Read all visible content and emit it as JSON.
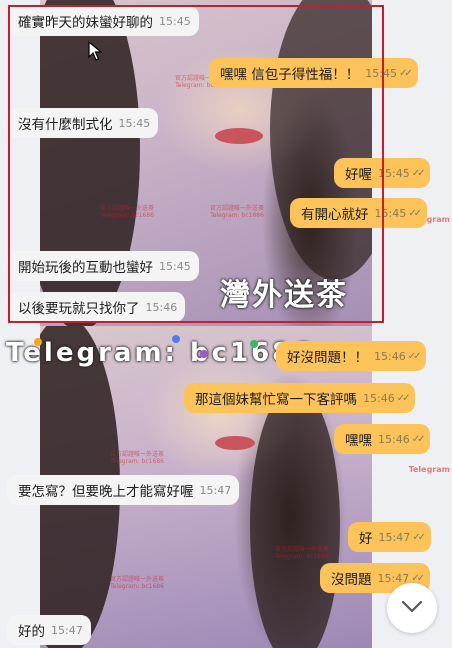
{
  "watermark": {
    "line1": "官方認證唯一外送茶",
    "line2": "Telegram: bc1686",
    "side": "Telegram",
    "banner": "外送茶",
    "banner_prefix": "灣",
    "telegram_overlay": "Telegram: bc1686"
  },
  "messages": [
    {
      "dir": "in",
      "text": "確實昨天的妹蠻好聊的",
      "time": "15:45"
    },
    {
      "dir": "out",
      "text": "嘿嘿 信包子得性福！！",
      "time": "15:45"
    },
    {
      "dir": "in",
      "text": "沒有什麼制式化",
      "time": "15:45"
    },
    {
      "dir": "out",
      "text": "好喔",
      "time": "15:45"
    },
    {
      "dir": "out",
      "text": "有開心就好",
      "time": "15:45"
    },
    {
      "dir": "in",
      "text": "開始玩後的互動也蠻好",
      "time": "15:45"
    },
    {
      "dir": "in",
      "text": "以後要玩就只找你了",
      "time": "15:46"
    },
    {
      "dir": "out",
      "text": "好沒問題！！",
      "time": "15:46"
    },
    {
      "dir": "out",
      "text": "那這個妹幫忙寫一下客評嗎",
      "time": "15:46"
    },
    {
      "dir": "out",
      "text": "嘿嘿",
      "time": "15:46"
    },
    {
      "dir": "in",
      "text": "要怎寫？但要晚上才能寫好喔",
      "time": "15:47"
    },
    {
      "dir": "out",
      "text": "好",
      "time": "15:47"
    },
    {
      "dir": "out",
      "text": "沒問題",
      "time": "15:47"
    },
    {
      "dir": "in",
      "text": "好的",
      "time": "15:47"
    }
  ],
  "read_ticks": "✓✓",
  "icons": {
    "scroll_down": "chevron-down-icon",
    "cursor": "mouse-pointer-icon"
  },
  "colors": {
    "outgoing_bubble": "#fbc35a",
    "incoming_bubble": "#f4f4f5",
    "selection_border": "#c3202b"
  }
}
